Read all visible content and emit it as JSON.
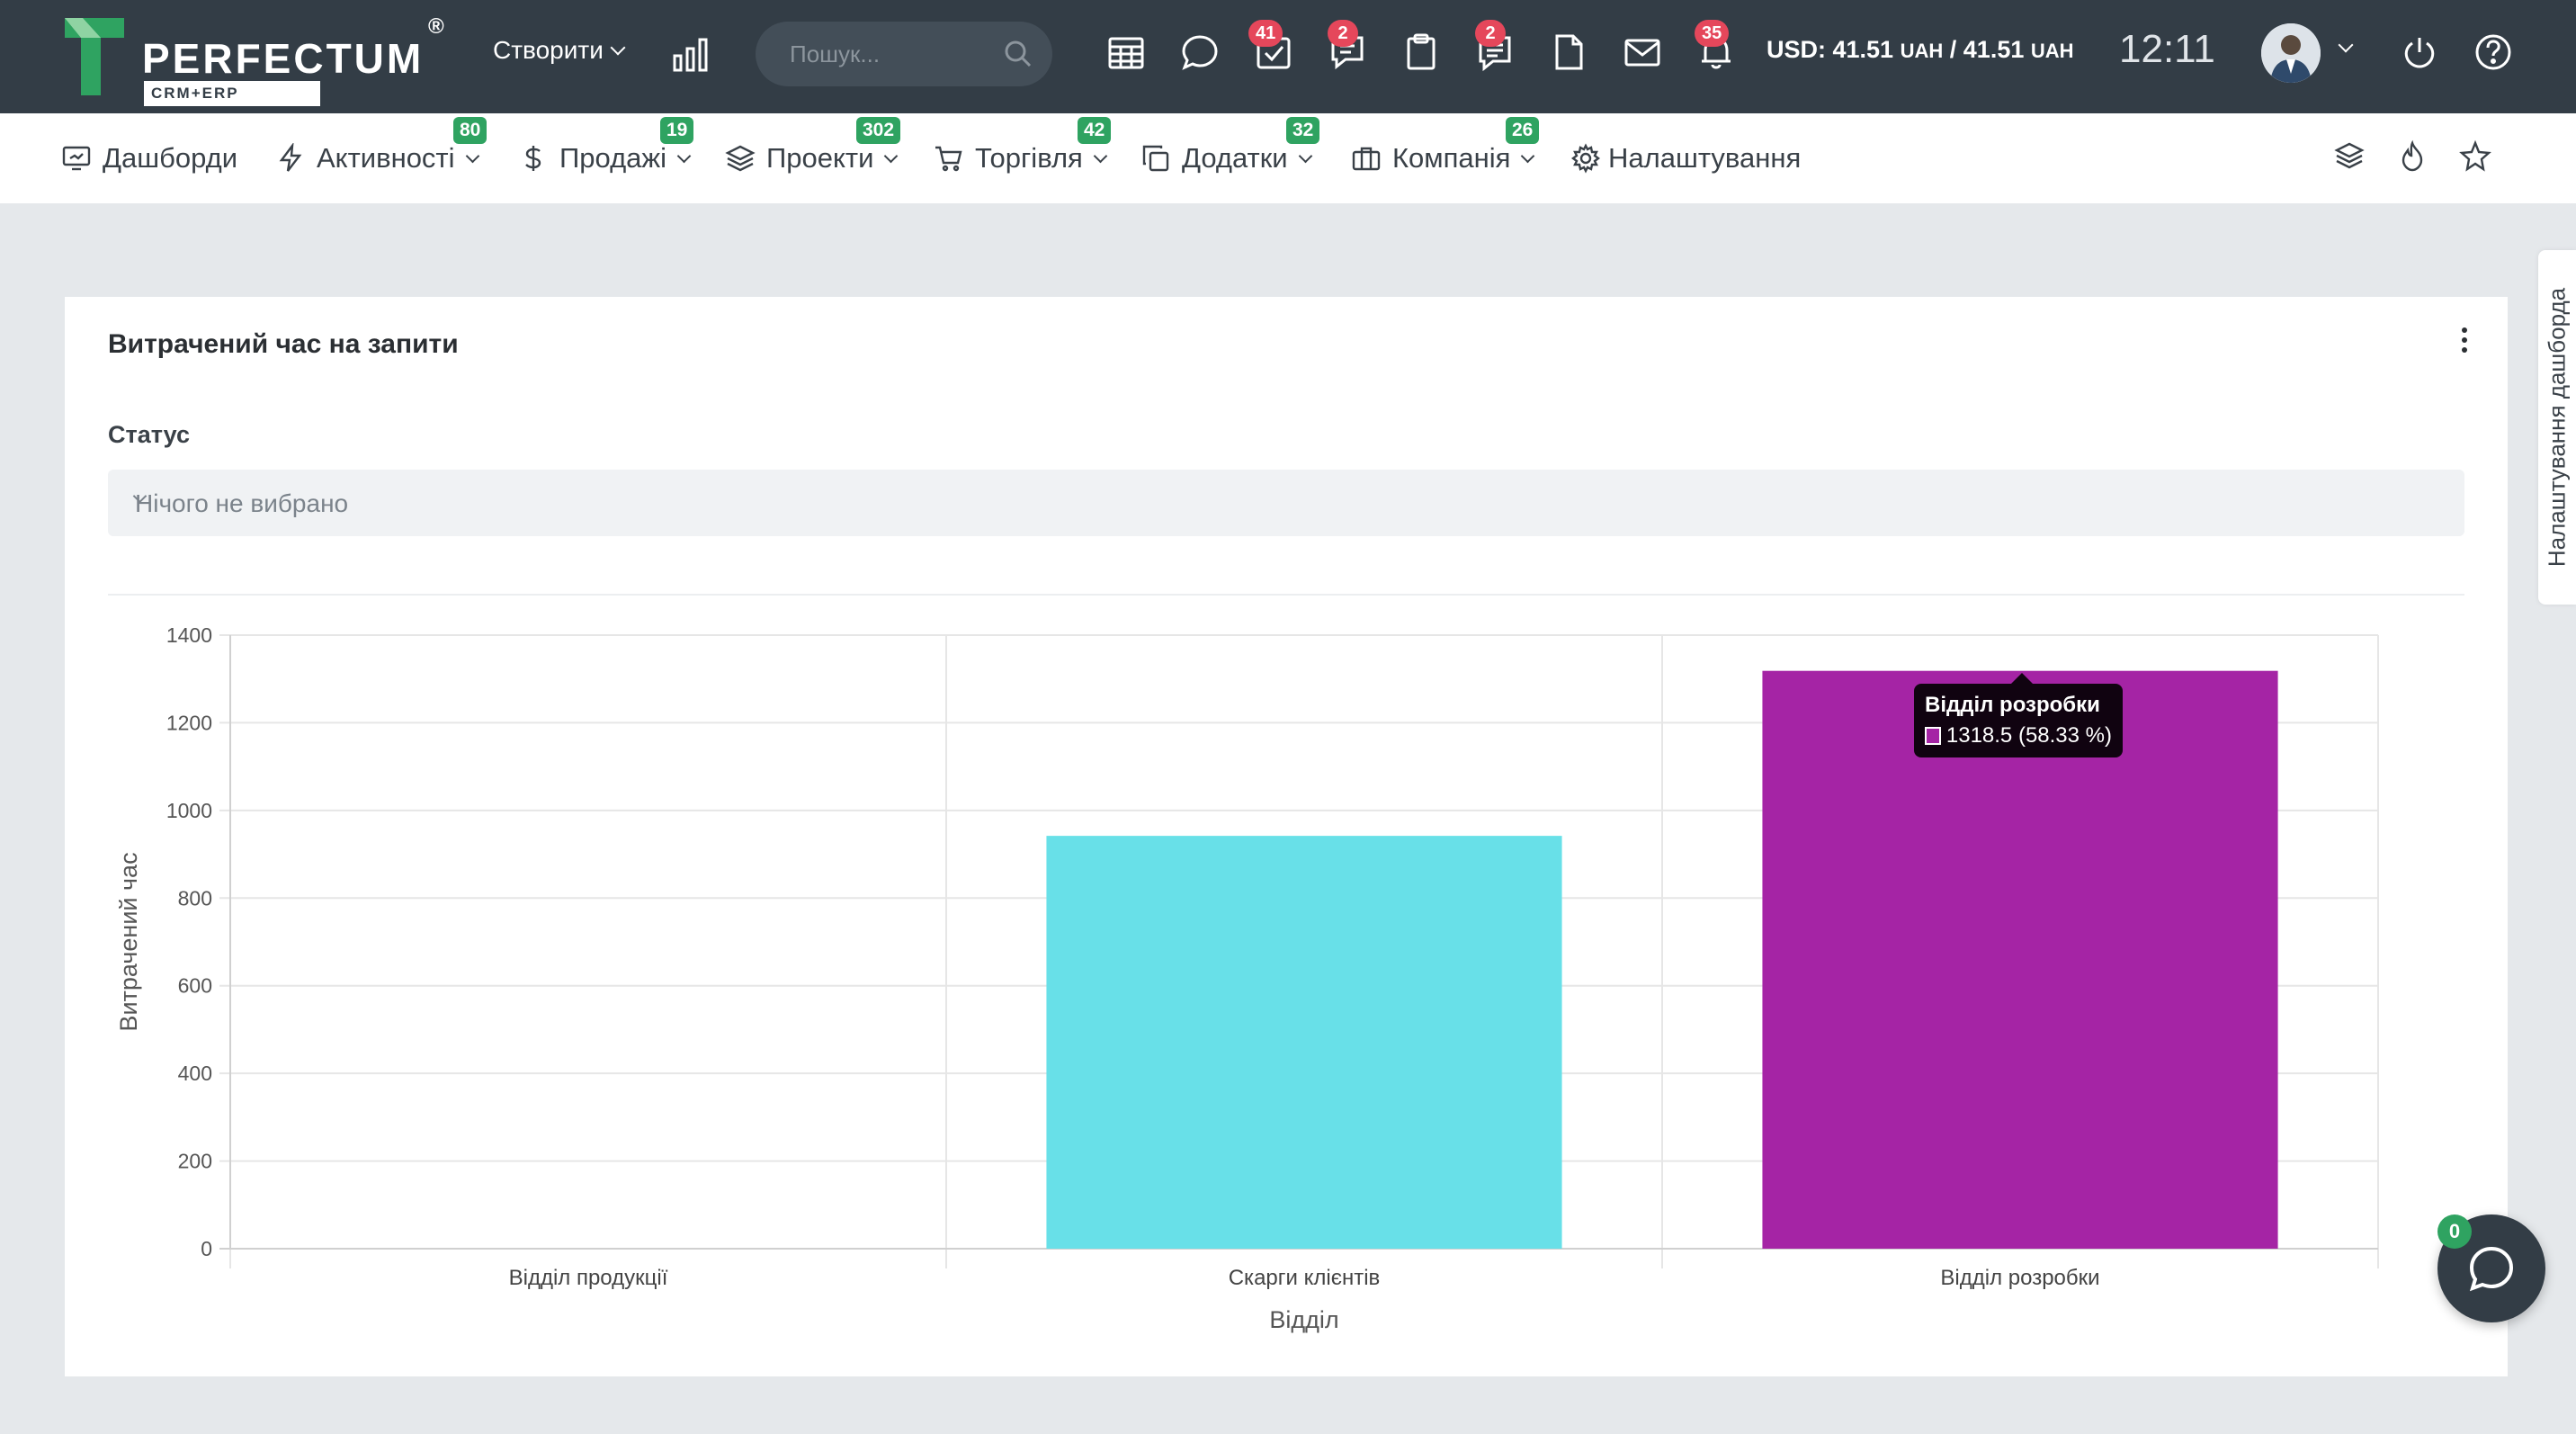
{
  "brand": {
    "name": "PERFECTUM",
    "registered": "®",
    "subtitle": "CRM+ERP",
    "accent": "#2fa361"
  },
  "header": {
    "create_label": "Створити",
    "search_placeholder": "Пошук...",
    "icons": [
      {
        "name": "calendar-icon",
        "badge": ""
      },
      {
        "name": "chat-bubble-icon",
        "badge": ""
      },
      {
        "name": "tasks-check-icon",
        "badge": "41"
      },
      {
        "name": "comments-icon",
        "badge": "2"
      },
      {
        "name": "clipboard-icon",
        "badge": ""
      },
      {
        "name": "notes-icon",
        "badge": "2"
      },
      {
        "name": "document-icon",
        "badge": ""
      },
      {
        "name": "mail-icon",
        "badge": ""
      },
      {
        "name": "bell-icon",
        "badge": "35"
      }
    ],
    "currency_usd": "USD: 41.51",
    "currency_unit1": "UAH",
    "currency_sep": " / 41.51",
    "currency_unit2": "UAH",
    "time": "12:11"
  },
  "nav": {
    "items": [
      {
        "label": "Дашборди",
        "badge": ""
      },
      {
        "label": "Активності",
        "badge": "80"
      },
      {
        "label": "Продажі",
        "badge": "19"
      },
      {
        "label": "Проекти",
        "badge": "302"
      },
      {
        "label": "Торгівля",
        "badge": "42"
      },
      {
        "label": "Додатки",
        "badge": "32"
      },
      {
        "label": "Компанія",
        "badge": "26"
      },
      {
        "label": "Налаштування",
        "badge": ""
      }
    ]
  },
  "side_tab": {
    "label": "Налаштування дашборда"
  },
  "widget": {
    "title": "Витрачений час на запити",
    "filter_label": "Статус",
    "filter_value": "Нічого не вибрано"
  },
  "chart_data": {
    "type": "bar",
    "categories": [
      "Відділ продукції",
      "Скарги клієнтів",
      "Відділ розробки"
    ],
    "values": [
      0,
      942,
      1318.5
    ],
    "colors": [
      "#4dc9f6",
      "#68e0e8",
      "#a524a5"
    ],
    "xlabel": "Відділ",
    "ylabel": "Витрачений час",
    "ylim": [
      0,
      1400
    ],
    "yticks": [
      "0",
      "200",
      "400",
      "600",
      "800",
      "1000",
      "1200",
      "1400"
    ],
    "grid": true,
    "tooltip": {
      "title": "Відділ розробки",
      "value": "1318.5 (58.33 %)",
      "color": "#a524a5"
    }
  },
  "chat": {
    "badge": "0"
  }
}
